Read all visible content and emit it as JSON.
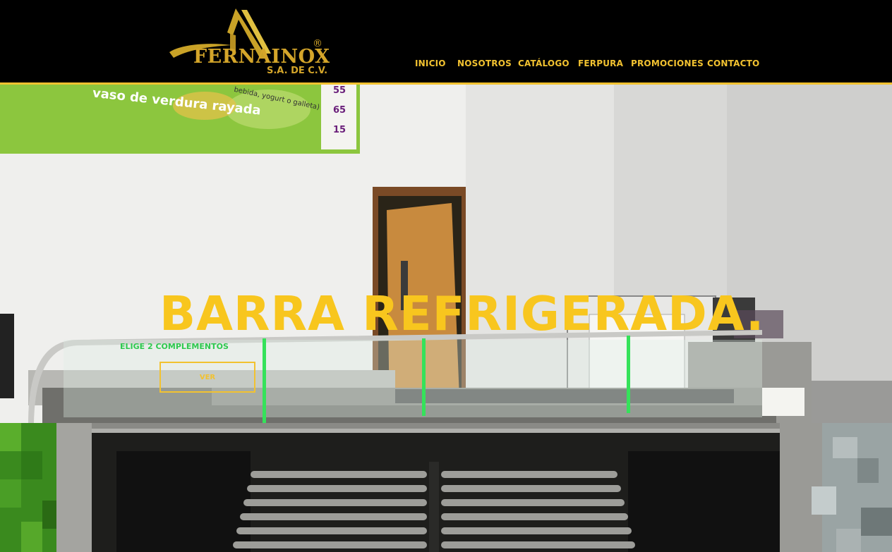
{
  "brand": {
    "name": "FERNAINOX",
    "registered_mark": "®",
    "subtitle": "S.A. DE C.V.",
    "logo_color": "#d4a52a"
  },
  "nav": {
    "items": [
      {
        "label": "INICIO"
      },
      {
        "label": "NOSOTROS"
      },
      {
        "label": "CATÁLOGO"
      },
      {
        "label": "FERPURA"
      },
      {
        "label": "PROMOCIONES"
      },
      {
        "label": "CONTACTO"
      }
    ],
    "color": "#f2c230"
  },
  "hero": {
    "title": "BARRA REFRIGERADA.",
    "button_label": "VER",
    "accent": "#f8c61e",
    "photo_signage": {
      "line1": "vaso de verdura rayada",
      "line2": "bebida, yogurt o galleta)",
      "prices": [
        "55",
        "65",
        "15"
      ],
      "glass_label": "ELIGE 2 COMPLEMENTOS"
    }
  }
}
